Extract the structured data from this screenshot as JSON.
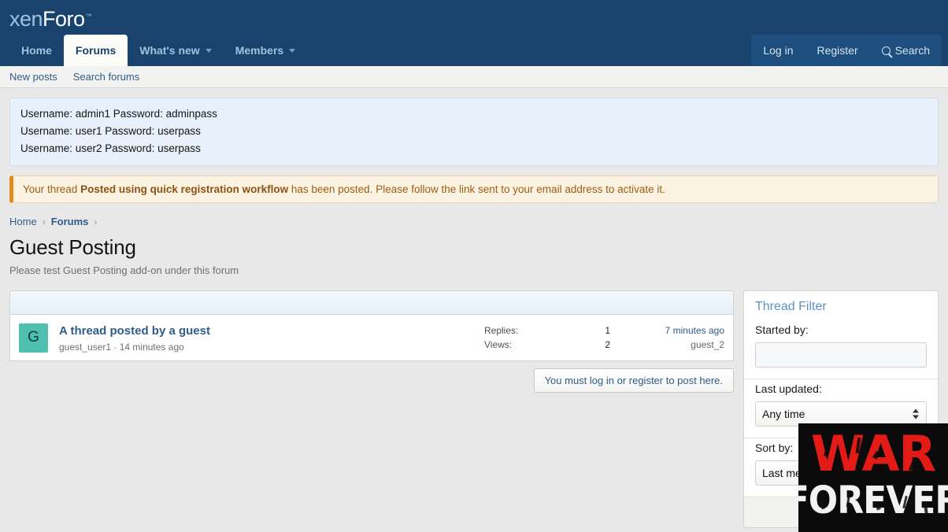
{
  "header": {
    "logo_xen": "xen",
    "logo_foro": "Foro",
    "logo_tm": "™",
    "tabs": [
      {
        "label": "Home",
        "active": false,
        "caret": false
      },
      {
        "label": "Forums",
        "active": true,
        "caret": false
      },
      {
        "label": "What's new",
        "active": false,
        "caret": true
      },
      {
        "label": "Members",
        "active": false,
        "caret": true
      }
    ],
    "right": {
      "login": "Log in",
      "register": "Register",
      "search": "Search",
      "search_icon": "search-icon"
    }
  },
  "subnav": {
    "items": [
      {
        "label": "New posts"
      },
      {
        "label": "Search forums"
      }
    ]
  },
  "credentials": {
    "lines": [
      "Username: admin1 Password: adminpass",
      "Username: user1 Password: userpass",
      "Username: user2 Password: userpass"
    ]
  },
  "notice": {
    "prefix": "Your thread ",
    "thread_title": "Posted using quick registration workflow",
    "suffix": " has been posted. Please follow the link sent to your email address to activate it."
  },
  "breadcrumb": {
    "home": "Home",
    "forums": "Forums",
    "separator": "›"
  },
  "page": {
    "title": "Guest Posting",
    "description": "Please test Guest Posting add-on under this forum"
  },
  "threads": [
    {
      "avatar_letter": "G",
      "avatar_color": "#4fc0b0",
      "title": "A thread posted by a guest",
      "author": "guest_user1",
      "meta_separator": "·",
      "posted_ago": "14 minutes ago",
      "replies_label": "Replies:",
      "replies_value": "1",
      "views_label": "Views:",
      "views_value": "2",
      "last_time": "7 minutes ago",
      "last_user": "guest_2"
    }
  ],
  "actions": {
    "login_notice": "You must log in or register to post here."
  },
  "sidebar": {
    "title": "Thread Filter",
    "started_by": {
      "label": "Started by:",
      "value": "",
      "placeholder": ""
    },
    "last_updated": {
      "label": "Last updated:",
      "selected": "Any time"
    },
    "sort_by": {
      "label": "Sort by:",
      "selected": "Last message"
    }
  },
  "ad_overlay": {
    "line1": "WAR",
    "line2": "FOREVER",
    "bg_color": "#0b0b0b",
    "line1_color": "#e31b17",
    "line2_color": "#f2f2f2"
  },
  "colors": {
    "header_bg": "#19436c",
    "link": "#2e5c8a",
    "notice_border": "#e08c20",
    "page_bg": "#e8e8e8"
  }
}
